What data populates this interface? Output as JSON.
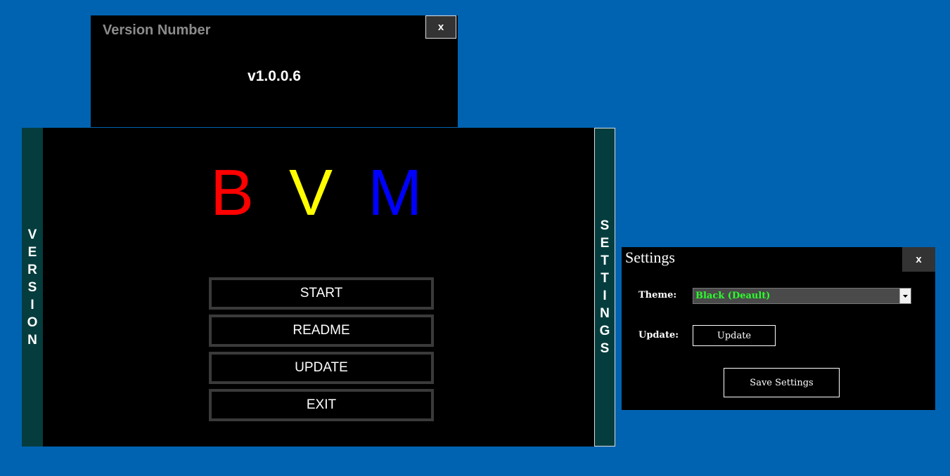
{
  "version_window": {
    "title": "Version Number",
    "close_label": "x",
    "version": "v1.0.0.6"
  },
  "main_window": {
    "version_tab_letters": [
      "V",
      "E",
      "R",
      "S",
      "I",
      "O",
      "N"
    ],
    "settings_tab_letters": [
      "S",
      "E",
      "T",
      "T",
      "I",
      "N",
      "G",
      "S"
    ],
    "logo": {
      "b": "B",
      "v": "V",
      "m": "M"
    },
    "buttons": {
      "start": "START",
      "readme": "README",
      "update": "UPDATE",
      "exit": "EXIT"
    }
  },
  "settings_window": {
    "title": "Settings",
    "close_label": "x",
    "theme_label": "Theme:",
    "theme_value": "Black (Deault)",
    "update_label": "Update:",
    "update_button": "Update",
    "save_button": "Save Settings"
  },
  "colors": {
    "desktop": "#0063b1",
    "tab": "#053d3e",
    "logo_b": "#ff0000",
    "logo_v": "#ffff00",
    "logo_m": "#0000ff",
    "theme_text": "#2bff2b"
  }
}
